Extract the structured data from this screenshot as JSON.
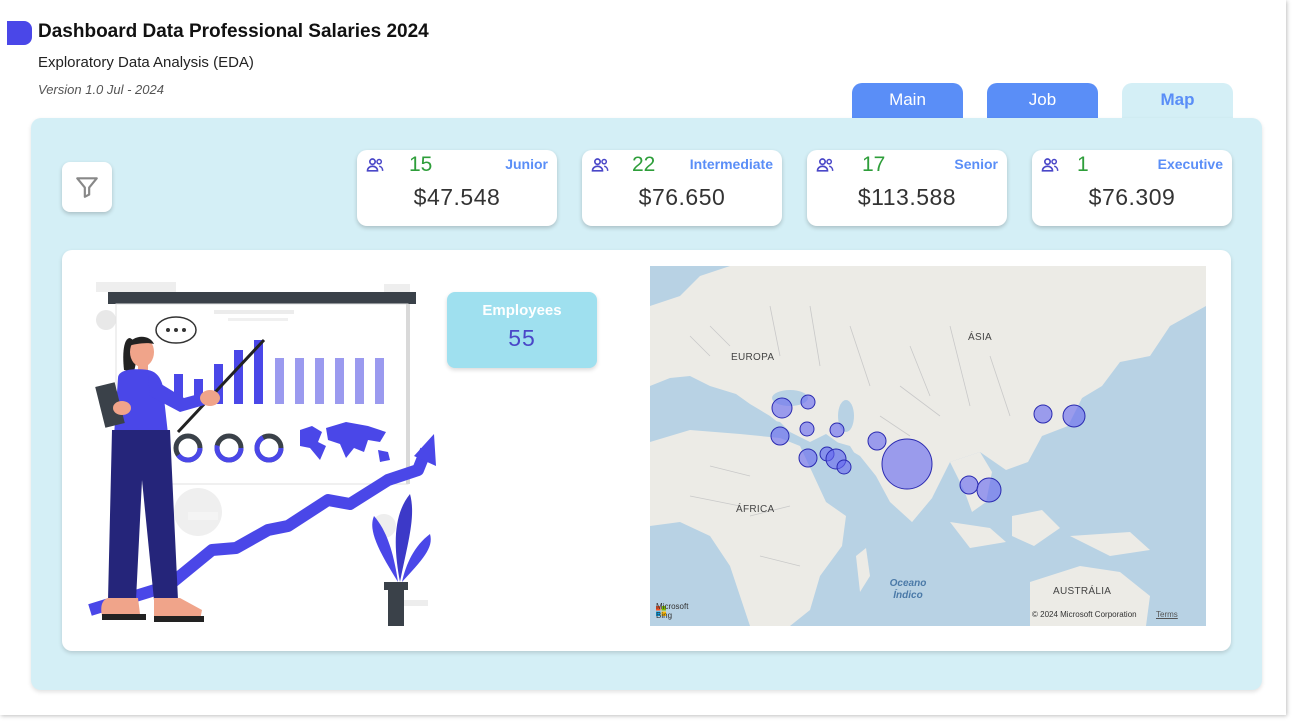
{
  "header": {
    "title": "Dashboard Data Professional Salaries 2024",
    "subtitle": "Exploratory Data Analysis (EDA)",
    "version": "Version 1.0 Jul - 2024"
  },
  "tabs": [
    {
      "label": "Main",
      "active": false
    },
    {
      "label": "Job",
      "active": false
    },
    {
      "label": "Map",
      "active": true
    }
  ],
  "filter": {
    "icon": "filter-icon"
  },
  "kpis": [
    {
      "level": "Junior",
      "count": "15",
      "salary": "$47.548",
      "icon": "people-icon"
    },
    {
      "level": "Intermediate",
      "count": "22",
      "salary": "$76.650",
      "icon": "people-icon"
    },
    {
      "level": "Senior",
      "count": "17",
      "salary": "$113.588",
      "icon": "people-icon"
    },
    {
      "level": "Executive",
      "count": "1",
      "salary": "$76.309",
      "icon": "people-icon"
    }
  ],
  "employees": {
    "label": "Employees",
    "value": "55"
  },
  "map": {
    "labels": {
      "europe": "EUROPA",
      "asia": "ÁSIA",
      "africa": "ÁFRICA",
      "australia": "AUSTRÁLIA",
      "ocean_line1": "Oceano",
      "ocean_line2": "Índico"
    },
    "provider": "Microsoft Bing",
    "copyright": "© 2024 Microsoft Corporation",
    "terms": "Terms"
  },
  "colors": {
    "accent": "#5a8ef7",
    "brand": "#4a47e8",
    "panel": "#d4eff6",
    "count_green": "#2e9e3a",
    "bubble": "#6466f0"
  }
}
